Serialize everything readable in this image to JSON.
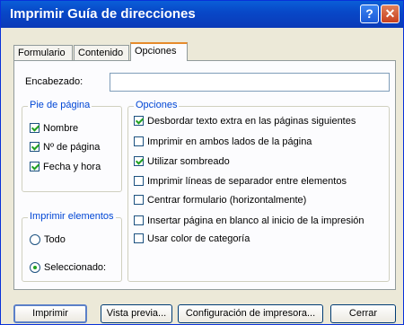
{
  "window": {
    "title": "Imprimir Guía de direcciones",
    "help_label": "?",
    "close_label": "✕"
  },
  "tabs": [
    {
      "label": "Formulario",
      "active": false
    },
    {
      "label": "Contenido",
      "active": false
    },
    {
      "label": "Opciones",
      "active": true
    }
  ],
  "header_field": {
    "label": "Encabezado:",
    "value": ""
  },
  "footer_group": {
    "title": "Pie de página",
    "items": [
      {
        "label": "Nombre",
        "checked": true
      },
      {
        "label": "Nº de página",
        "checked": true
      },
      {
        "label": "Fecha y hora",
        "checked": true
      }
    ]
  },
  "print_group": {
    "title": "Imprimir elementos",
    "items": [
      {
        "label": "Todo",
        "selected": false
      },
      {
        "label": "Seleccionado:",
        "selected": true
      }
    ]
  },
  "options_group": {
    "title": "Opciones",
    "items": [
      {
        "label": "Desbordar texto extra en las páginas siguientes",
        "checked": true
      },
      {
        "label": "Imprimir en ambos lados de la página",
        "checked": false
      },
      {
        "label": "Utilizar sombreado",
        "checked": true
      },
      {
        "label": "Imprimir líneas de separador entre elementos",
        "checked": false
      },
      {
        "label": "Centrar formulario (horizontalmente)",
        "checked": false
      },
      {
        "label": "Insertar página en blanco al inicio de la impresión",
        "checked": false
      },
      {
        "label": "Usar color de categoría",
        "checked": false
      }
    ]
  },
  "buttons": {
    "print": "Imprimir",
    "preview": "Vista previa...",
    "printer_setup": "Configuración de impresora...",
    "cancel": "Cerrar"
  }
}
